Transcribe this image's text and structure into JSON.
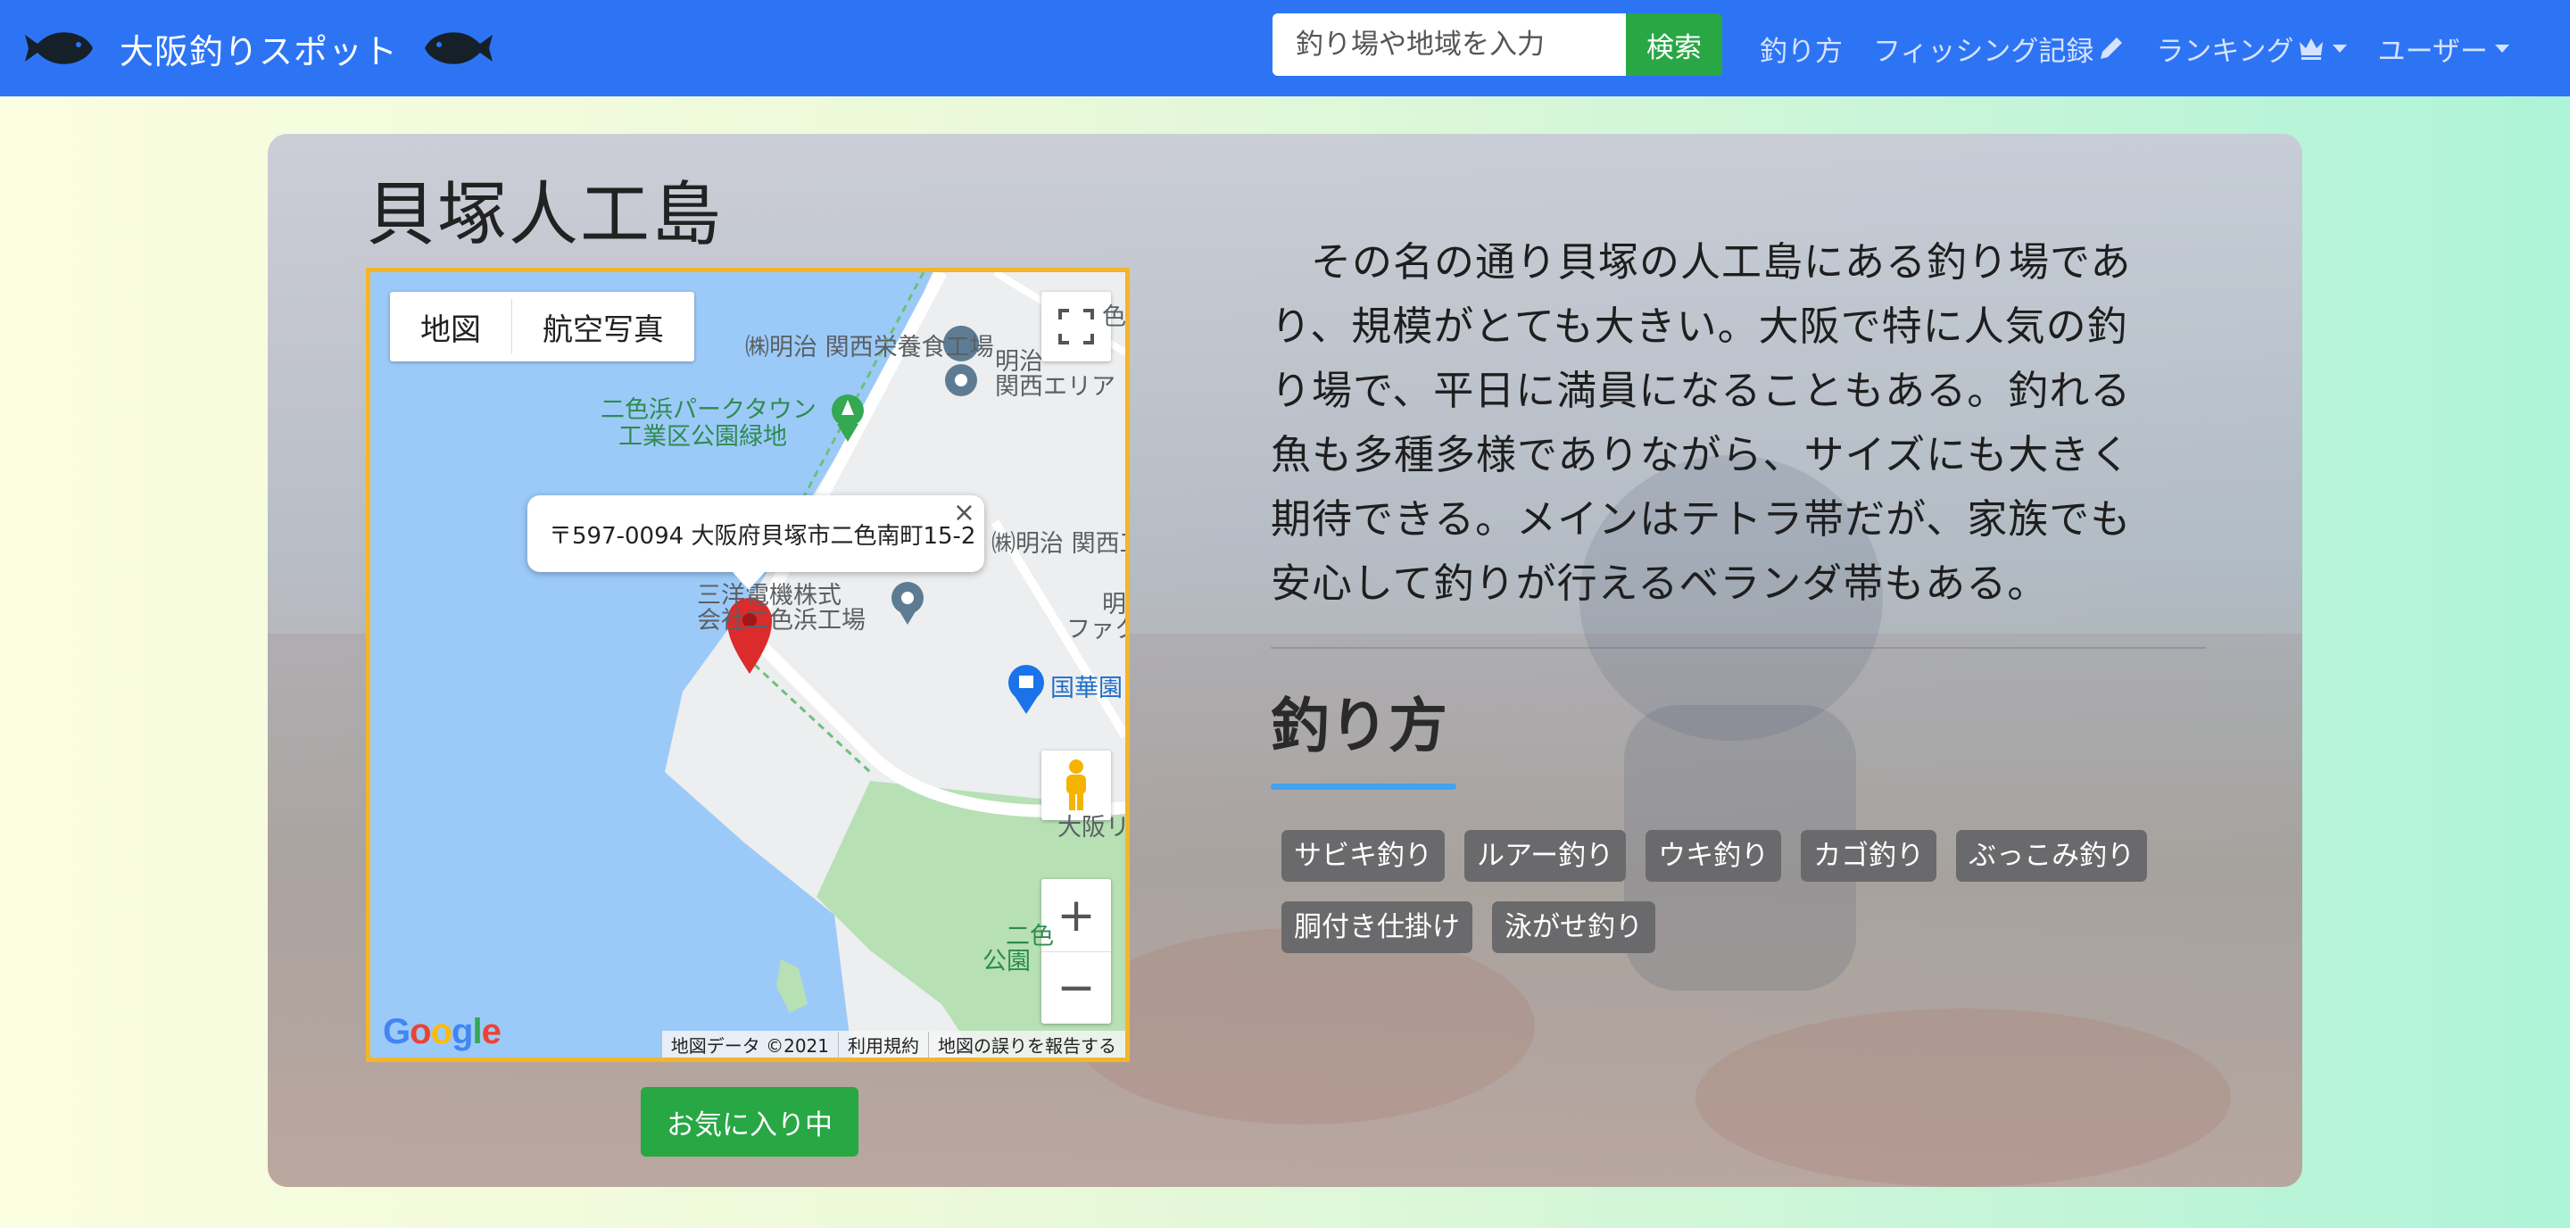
{
  "nav": {
    "brand": "大阪釣りスポット",
    "search_placeholder": "釣り場や地域を入力",
    "search_button": "検索",
    "links": [
      "釣り方",
      "フィッシング記録",
      "ランキング",
      "ユーザー"
    ]
  },
  "spot": {
    "title": "貝塚人工島",
    "description": "その名の通り貝塚の人工島にある釣り場であり、規模がとても大きい。大阪で特に人気の釣り場で、平日に満員になることもある。釣れる魚も多種多様でありながら、サイズにも大きく期待できる。メインはテトラ帯だが、家族でも安心して釣りが行えるベランダ帯もある。",
    "method_heading": "釣り方",
    "methods": [
      "サビキ釣り",
      "ルアー釣り",
      "ウキ釣り",
      "カゴ釣り",
      "ぶっこみ釣り",
      "胴付き仕掛け",
      "泳がせ釣り"
    ],
    "favorite_button": "お気に入り中"
  },
  "map": {
    "type_map": "地図",
    "type_satellite": "航空写真",
    "info_address": "〒597-0094 大阪府貝塚市二色南町15-2",
    "labels": {
      "meiji_kansai": "㈱明治 関西栄養食工場",
      "meiji_kansai_area_1": "明治",
      "meiji_kansai_area_2": "関西エリア",
      "park_1": "二色浜パークタウン",
      "park_2": "工業区公園緑地",
      "meiji_2": "㈱明治 関西工",
      "factory_1": "三洋電機株式",
      "factory_2": "会社二色浜工場",
      "factory_r1": "明",
      "factory_r2": "ファク",
      "kokaen": "国華園",
      "osaka_r": "大阪リ",
      "park_b1": "二色",
      "park_b2": "公園",
      "corner_top": "色"
    },
    "google": "Google",
    "attribution": [
      "地図データ ©2021",
      "利用規約",
      "地図の誤りを報告する"
    ],
    "colors": {
      "water": "#9ccaf8",
      "land": "#eceeef",
      "park": "#b7e0b4",
      "border": "#f4b52a"
    }
  },
  "colors": {
    "navbar": "#2d74f5",
    "success": "#28a745",
    "tag": "#6a6a6c",
    "accent": "#44a2ef"
  }
}
